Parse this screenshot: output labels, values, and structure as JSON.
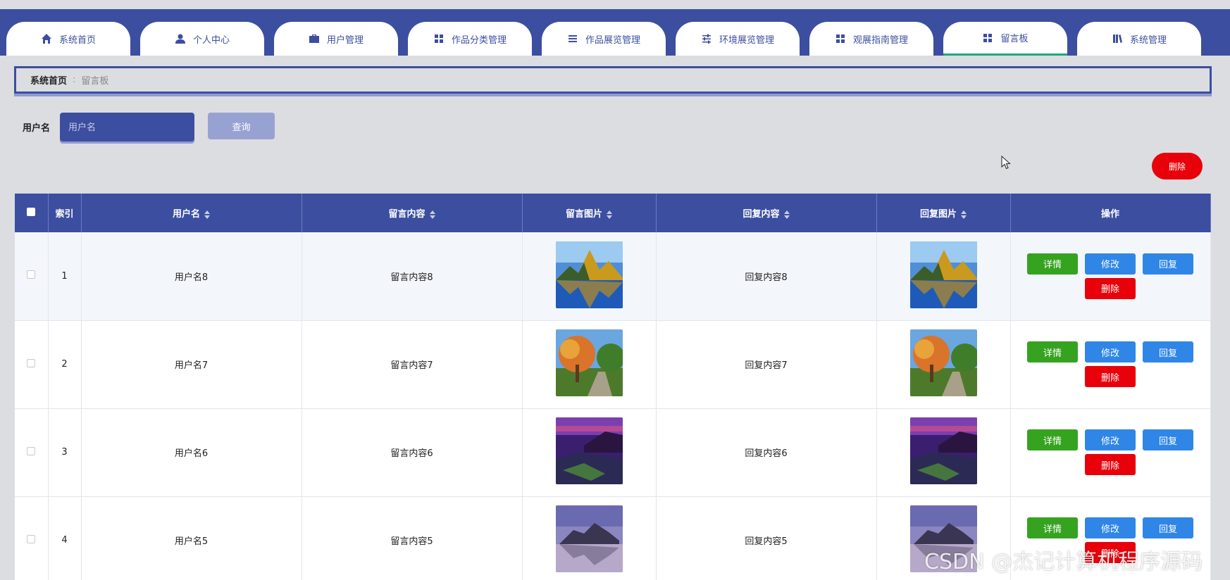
{
  "nav": {
    "tabs": [
      {
        "label": "系统首页",
        "icon": "home-icon"
      },
      {
        "label": "个人中心",
        "icon": "user-icon"
      },
      {
        "label": "用户管理",
        "icon": "briefcase-icon"
      },
      {
        "label": "作品分类管理",
        "icon": "grid-icon"
      },
      {
        "label": "作品展览管理",
        "icon": "list-icon"
      },
      {
        "label": "环境展览管理",
        "icon": "sliders-icon"
      },
      {
        "label": "观展指南管理",
        "icon": "grid-icon"
      },
      {
        "label": "留言板",
        "icon": "grid-icon"
      },
      {
        "label": "系统管理",
        "icon": "book-icon"
      }
    ],
    "active_index": 7
  },
  "breadcrumb": {
    "home": "系统首页",
    "current": "留言板"
  },
  "search": {
    "label": "用户名",
    "placeholder": "用户名",
    "button": "查询"
  },
  "toolbar": {
    "delete_label": "删除"
  },
  "table": {
    "headers": {
      "index": "索引",
      "username": "用户名",
      "content": "留言内容",
      "image": "留言图片",
      "reply": "回复内容",
      "reply_image": "回复图片",
      "actions": "操作"
    },
    "rows": [
      {
        "index": "1",
        "username": "用户名8",
        "content": "留言内容8",
        "reply": "回复内容8",
        "image": "mountain-lake-photo"
      },
      {
        "index": "2",
        "username": "用户名7",
        "content": "留言内容7",
        "reply": "回复内容7",
        "image": "autumn-tree-photo"
      },
      {
        "index": "3",
        "username": "用户名6",
        "content": "留言内容6",
        "reply": "回复内容6",
        "image": "purple-coast-photo"
      },
      {
        "index": "4",
        "username": "用户名5",
        "content": "留言内容5",
        "reply": "回复内容5",
        "image": "misty-mountain-photo"
      }
    ],
    "actions": {
      "detail": "详情",
      "edit": "修改",
      "reply": "回复",
      "delete": "删除"
    }
  },
  "watermark": "CSDN @杰记计算机程序源码",
  "colors": {
    "primary": "#3c4ea0",
    "danger": "#e8000b",
    "success": "#35a31f",
    "info": "#2f86e6"
  }
}
